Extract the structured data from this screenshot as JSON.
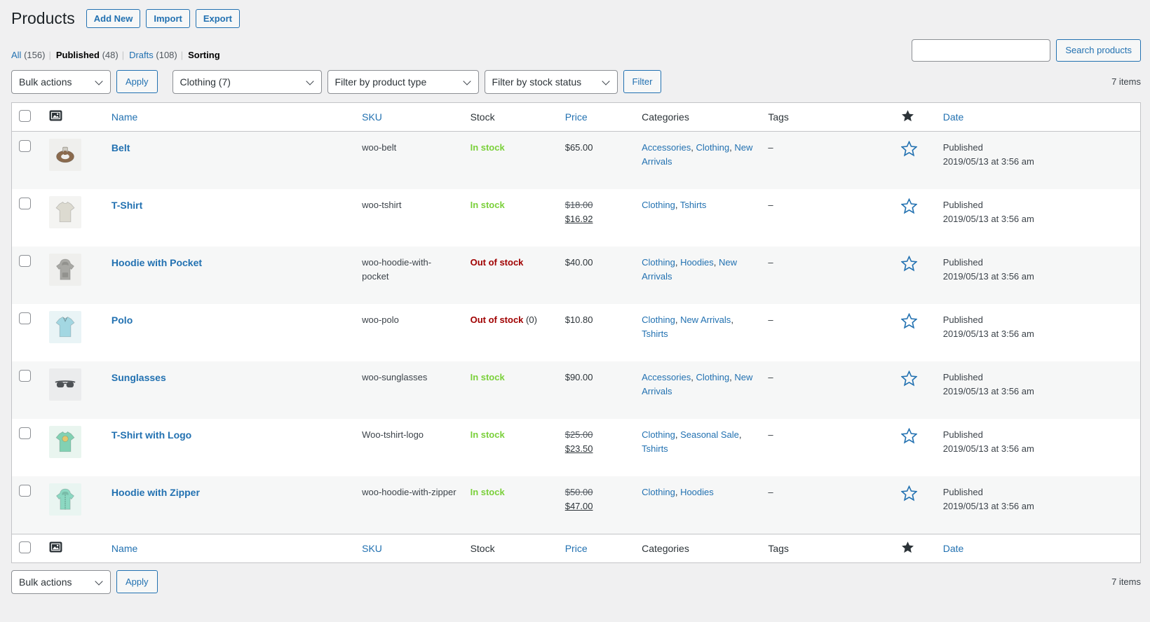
{
  "colors": {
    "accent": "#2271b1",
    "in_stock": "#7ad03a",
    "out_of_stock": "#a00000",
    "text": "#2c3338"
  },
  "header": {
    "title": "Products",
    "add_new_label": "Add New",
    "import_label": "Import",
    "export_label": "Export"
  },
  "views": [
    {
      "label": "All",
      "count": "(156)",
      "state": "link"
    },
    {
      "label": "Published",
      "count": "(48)",
      "state": "current"
    },
    {
      "label": "Drafts",
      "count": "(108)",
      "state": "link"
    },
    {
      "label": "Sorting",
      "count": "",
      "state": "current"
    }
  ],
  "search": {
    "value": "",
    "button_label": "Search products"
  },
  "tablenav_top": {
    "bulk_actions_value": "Bulk actions",
    "apply_label": "Apply",
    "category_filter_value": "Clothing  (7)",
    "product_type_filter_value": "Filter by product type",
    "stock_filter_value": "Filter by stock status",
    "filter_button_label": "Filter",
    "items_count": "7 items"
  },
  "tablenav_bottom": {
    "bulk_actions_value": "Bulk actions",
    "apply_label": "Apply",
    "items_count": "7 items"
  },
  "table": {
    "columns": {
      "name": "Name",
      "sku": "SKU",
      "stock": "Stock",
      "price": "Price",
      "categories": "Categories",
      "tags": "Tags",
      "featured": "star-icon",
      "date": "Date"
    },
    "rows": [
      {
        "name": "Belt",
        "sku": "woo-belt",
        "stock": {
          "label": "In stock",
          "status": "in",
          "suffix": ""
        },
        "price": {
          "regular": "$65.00",
          "sale": ""
        },
        "categories": [
          "Accessories",
          "Clothing",
          "New Arrivals"
        ],
        "tags": "–",
        "date": {
          "status": "Published",
          "datetime": "2019/05/13 at 3:56 am"
        },
        "thumb": {
          "icon": "belt-thumbnail",
          "type": "belt",
          "bg": "#efefed",
          "fg": "#8a6a4d"
        }
      },
      {
        "name": "T-Shirt",
        "sku": "woo-tshirt",
        "stock": {
          "label": "In stock",
          "status": "in",
          "suffix": ""
        },
        "price": {
          "regular": "$18.00",
          "sale": "$16.92"
        },
        "categories": [
          "Clothing",
          "Tshirts"
        ],
        "tags": "–",
        "date": {
          "status": "Published",
          "datetime": "2019/05/13 at 3:56 am"
        },
        "thumb": {
          "icon": "tshirt-thumbnail",
          "type": "tshirt",
          "bg": "#f4f4f2",
          "fg": "#dcdad0"
        }
      },
      {
        "name": "Hoodie with Pocket",
        "sku": "woo-hoodie-with-pocket",
        "stock": {
          "label": "Out of stock",
          "status": "out",
          "suffix": ""
        },
        "price": {
          "regular": "$40.00",
          "sale": ""
        },
        "categories": [
          "Clothing",
          "Hoodies",
          "New Arrivals"
        ],
        "tags": "–",
        "date": {
          "status": "Published",
          "datetime": "2019/05/13 at 3:56 am"
        },
        "thumb": {
          "icon": "hoodie-thumbnail",
          "type": "hoodie",
          "bg": "#efefed",
          "fg": "#a8a8a4"
        }
      },
      {
        "name": "Polo",
        "sku": "woo-polo",
        "stock": {
          "label": "Out of stock",
          "status": "out",
          "suffix": "(0)"
        },
        "price": {
          "regular": "$10.80",
          "sale": ""
        },
        "categories": [
          "Clothing",
          "New Arrivals",
          "Tshirts"
        ],
        "tags": "–",
        "date": {
          "status": "Published",
          "datetime": "2019/05/13 at 3:56 am"
        },
        "thumb": {
          "icon": "polo-thumbnail",
          "type": "polo",
          "bg": "#e9f4f6",
          "fg": "#a3d7e2"
        }
      },
      {
        "name": "Sunglasses",
        "sku": "woo-sunglasses",
        "stock": {
          "label": "In stock",
          "status": "in",
          "suffix": ""
        },
        "price": {
          "regular": "$90.00",
          "sale": ""
        },
        "categories": [
          "Accessories",
          "Clothing",
          "New Arrivals"
        ],
        "tags": "–",
        "date": {
          "status": "Published",
          "datetime": "2019/05/13 at 3:56 am"
        },
        "thumb": {
          "icon": "sunglasses-thumbnail",
          "type": "sunglasses",
          "bg": "#ebeced",
          "fg": "#4e5256"
        }
      },
      {
        "name": "T-Shirt with Logo",
        "sku": "Woo-tshirt-logo",
        "stock": {
          "label": "In stock",
          "status": "in",
          "suffix": ""
        },
        "price": {
          "regular": "$25.00",
          "sale": "$23.50"
        },
        "categories": [
          "Clothing",
          "Seasonal Sale",
          "Tshirts"
        ],
        "tags": "–",
        "date": {
          "status": "Published",
          "datetime": "2019/05/13 at 3:56 am"
        },
        "thumb": {
          "icon": "tshirt-logo-thumbnail",
          "type": "tshirt-logo",
          "bg": "#e9f5ef",
          "fg": "#82d1b3",
          "accent": "#e4c76e"
        }
      },
      {
        "name": "Hoodie with Zipper",
        "sku": "woo-hoodie-with-zipper",
        "stock": {
          "label": "In stock",
          "status": "in",
          "suffix": ""
        },
        "price": {
          "regular": "$50.00",
          "sale": "$47.00"
        },
        "categories": [
          "Clothing",
          "Hoodies"
        ],
        "tags": "–",
        "date": {
          "status": "Published",
          "datetime": "2019/05/13 at 3:56 am"
        },
        "thumb": {
          "icon": "hoodie-zipper-thumbnail",
          "type": "hoodie-zipper",
          "bg": "#e9f5f1",
          "fg": "#8cd8c2"
        }
      }
    ]
  }
}
